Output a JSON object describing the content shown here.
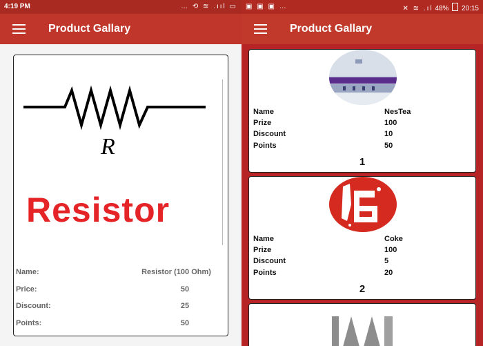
{
  "left": {
    "status": {
      "time": "4:19 PM",
      "icons": "… ⟲ ≋ .ııl ▭"
    },
    "appbar": {
      "title": "Product Gallary",
      "menu_icon": "hamburger-menu-icon"
    },
    "card": {
      "image_letter": "R",
      "image_word": "Resistor",
      "labels": {
        "name": "Name:",
        "price": "Price:",
        "discount": "Discount:",
        "points": "Points:"
      },
      "values": {
        "name": "Resistor (100 Ohm)",
        "price": "50",
        "discount": "25",
        "points": "50"
      }
    }
  },
  "right": {
    "status": {
      "left_icons": "▣ ▣ ▣ …",
      "right_icons": "✕ ≋ .ıl",
      "battery": "48%",
      "time": "20:15"
    },
    "appbar": {
      "title": "Product Gallary",
      "menu_icon": "hamburger-menu-icon"
    },
    "labels": {
      "name": "Name",
      "price": "Prize",
      "discount": "Discount",
      "points": "Points"
    },
    "products": [
      {
        "index": "1",
        "name": "NesTea",
        "price": "100",
        "discount": "10",
        "points": "50"
      },
      {
        "index": "2",
        "name": "Coke",
        "price": "100",
        "discount": "5",
        "points": "20"
      }
    ]
  }
}
